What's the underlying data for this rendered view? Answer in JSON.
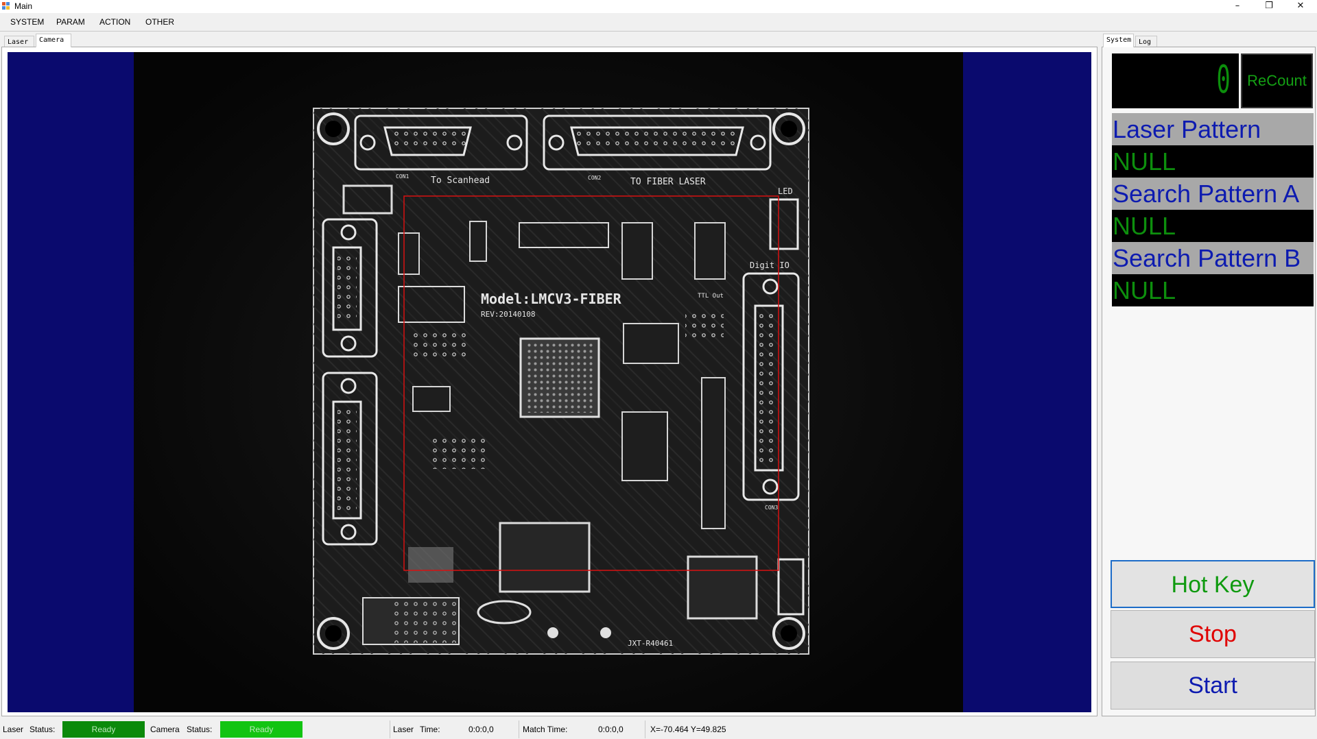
{
  "window": {
    "title": "Main",
    "minimize": "–",
    "restore": "❐",
    "close": "✕"
  },
  "menu": [
    "SYSTEM",
    "PARAM",
    "ACTION",
    "OTHER"
  ],
  "left_tabs": [
    {
      "label": "Laser",
      "active": false
    },
    {
      "label": "Camera",
      "active": true
    }
  ],
  "right_tabs": [
    {
      "label": "System",
      "active": true
    },
    {
      "label": "Log",
      "active": false
    }
  ],
  "camera": {
    "board_silkscreen": [
      "To Scanhead",
      "TO FIBER LASER",
      "LED",
      "Digit IO",
      "Model:LMCV3-FIBER",
      "REV:20140108",
      "TTL Out",
      "JXT-R40461",
      "CON1",
      "CON2",
      "CON3"
    ]
  },
  "counter": {
    "value": "0",
    "recount_label": "ReCount"
  },
  "patterns": [
    {
      "label": "Laser Pattern",
      "value": "NULL"
    },
    {
      "label": "Search Pattern A",
      "value": "NULL"
    },
    {
      "label": "Search Pattern B",
      "value": "NULL"
    }
  ],
  "buttons": {
    "hotkey": {
      "label": "Hot Key",
      "color": "#0f9a0f"
    },
    "stop": {
      "label": "Stop",
      "color": "#e00000"
    },
    "start": {
      "label": "Start",
      "color": "#0d1bb0"
    }
  },
  "status": {
    "laser_label": "Laser",
    "laser_status_label": "Status:",
    "laser_status_value": "Ready",
    "camera_label": "Camera",
    "camera_status_label": "Status:",
    "camera_status_value": "Ready",
    "laser_time_label": "Laser",
    "laser_time_caption": "Time:",
    "laser_time_value": "0:0:0,0",
    "match_time_label": "Match Time:",
    "match_time_value": "0:0:0,0",
    "coords": "X=-70.464  Y=49.825",
    "laser_ready_color": "#0b8a0b",
    "camera_ready_color": "#12c412"
  }
}
